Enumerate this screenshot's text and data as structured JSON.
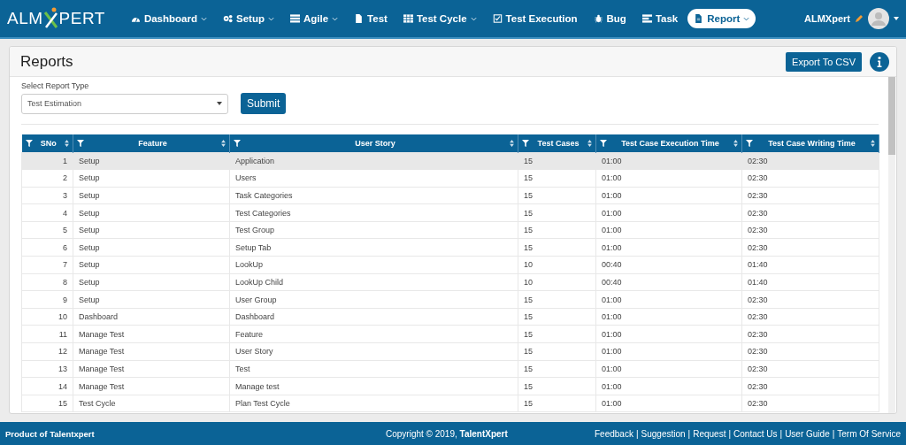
{
  "logo": {
    "left": "ALM",
    "right": "PERT"
  },
  "nav": [
    {
      "label": "Dashboard",
      "kind": "dashboard",
      "dropdown": true,
      "selected": false
    },
    {
      "label": "Setup",
      "kind": "gears",
      "dropdown": true,
      "selected": false
    },
    {
      "label": "Agile",
      "kind": "list",
      "dropdown": true,
      "selected": false
    },
    {
      "label": "Test",
      "kind": "file",
      "dropdown": false,
      "selected": false
    },
    {
      "label": "Test Cycle",
      "kind": "grid",
      "dropdown": true,
      "selected": false
    },
    {
      "label": "Test Execution",
      "kind": "check",
      "dropdown": false,
      "selected": false
    },
    {
      "label": "Bug",
      "kind": "bug",
      "dropdown": false,
      "selected": false
    },
    {
      "label": "Task",
      "kind": "tasks",
      "dropdown": false,
      "selected": false
    },
    {
      "label": "Report",
      "kind": "file",
      "dropdown": true,
      "selected": true
    }
  ],
  "user": {
    "name": "ALMXpert"
  },
  "page": {
    "title": "Reports",
    "export_button": "Export To CSV"
  },
  "report_type": {
    "label": "Select Report Type",
    "value": "Test Estimation"
  },
  "submit_button": "Submit",
  "table": {
    "columns": [
      {
        "label": "SNo"
      },
      {
        "label": "Feature"
      },
      {
        "label": "User Story"
      },
      {
        "label": "Test Cases"
      },
      {
        "label": "Test Case Execution Time"
      },
      {
        "label": "Test Case Writing Time"
      }
    ],
    "rows": [
      {
        "cells": [
          "1",
          "Setup",
          "Application",
          "15",
          "01:00",
          "02:30"
        ],
        "selected": true
      },
      {
        "cells": [
          "2",
          "Setup",
          "Users",
          "15",
          "01:00",
          "02:30"
        ],
        "selected": false
      },
      {
        "cells": [
          "3",
          "Setup",
          "Task Categories",
          "15",
          "01:00",
          "02:30"
        ],
        "selected": false
      },
      {
        "cells": [
          "4",
          "Setup",
          "Test Categories",
          "15",
          "01:00",
          "02:30"
        ],
        "selected": false
      },
      {
        "cells": [
          "5",
          "Setup",
          "Test Group",
          "15",
          "01:00",
          "02:30"
        ],
        "selected": false
      },
      {
        "cells": [
          "6",
          "Setup",
          "Setup Tab",
          "15",
          "01:00",
          "02:30"
        ],
        "selected": false
      },
      {
        "cells": [
          "7",
          "Setup",
          "LookUp",
          "10",
          "00:40",
          "01:40"
        ],
        "selected": false
      },
      {
        "cells": [
          "8",
          "Setup",
          "LookUp Child",
          "10",
          "00:40",
          "01:40"
        ],
        "selected": false
      },
      {
        "cells": [
          "9",
          "Setup",
          "User Group",
          "15",
          "01:00",
          "02:30"
        ],
        "selected": false
      },
      {
        "cells": [
          "10",
          "Dashboard",
          "Dashboard",
          "15",
          "01:00",
          "02:30"
        ],
        "selected": false
      },
      {
        "cells": [
          "11",
          "Manage Test",
          "Feature",
          "15",
          "01:00",
          "02:30"
        ],
        "selected": false
      },
      {
        "cells": [
          "12",
          "Manage Test",
          "User Story",
          "15",
          "01:00",
          "02:30"
        ],
        "selected": false
      },
      {
        "cells": [
          "13",
          "Manage Test",
          "Test",
          "15",
          "01:00",
          "02:30"
        ],
        "selected": false
      },
      {
        "cells": [
          "14",
          "Manage Test",
          "Manage test",
          "15",
          "01:00",
          "02:30"
        ],
        "selected": false
      },
      {
        "cells": [
          "15",
          "Test Cycle",
          "Plan Test Cycle",
          "15",
          "01:00",
          "02:30"
        ],
        "selected": false
      }
    ]
  },
  "footer": {
    "product": "Product of Talentxpert",
    "copyright": "Copyright © 2019, **TalentXpert**",
    "separator": "|",
    "links": [
      "Feedback",
      "Suggestion",
      "Request",
      "Contact Us",
      "User Guide",
      "Term Of Service"
    ]
  }
}
